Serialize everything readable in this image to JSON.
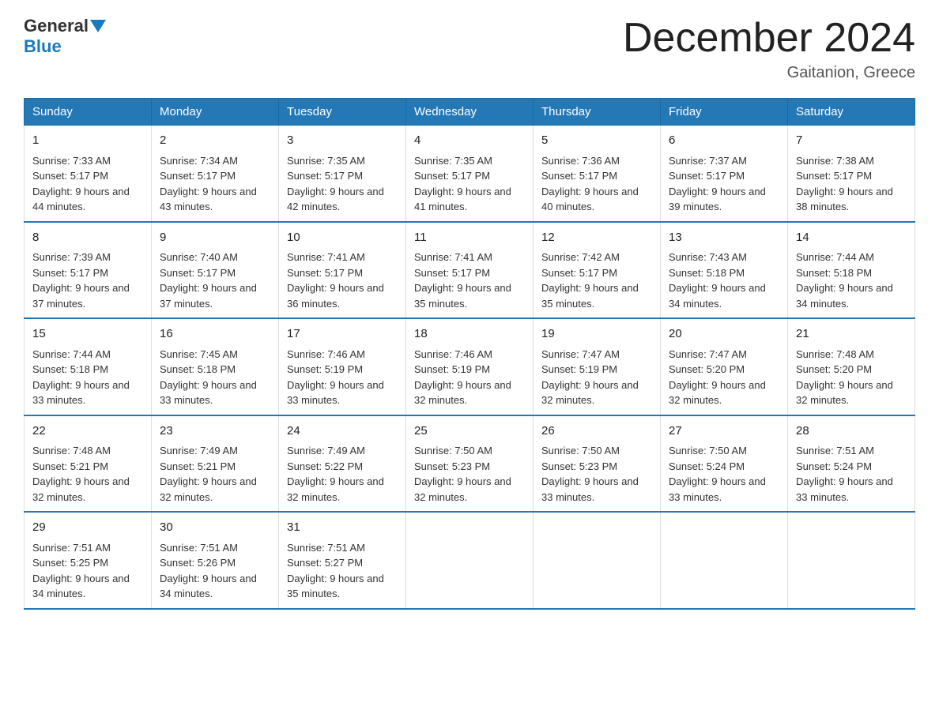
{
  "header": {
    "logo_general": "General",
    "logo_blue": "Blue",
    "title": "December 2024",
    "location": "Gaitanion, Greece"
  },
  "weekdays": [
    "Sunday",
    "Monday",
    "Tuesday",
    "Wednesday",
    "Thursday",
    "Friday",
    "Saturday"
  ],
  "weeks": [
    [
      {
        "day": "1",
        "sunrise": "7:33 AM",
        "sunset": "5:17 PM",
        "daylight": "9 hours and 44 minutes."
      },
      {
        "day": "2",
        "sunrise": "7:34 AM",
        "sunset": "5:17 PM",
        "daylight": "9 hours and 43 minutes."
      },
      {
        "day": "3",
        "sunrise": "7:35 AM",
        "sunset": "5:17 PM",
        "daylight": "9 hours and 42 minutes."
      },
      {
        "day": "4",
        "sunrise": "7:35 AM",
        "sunset": "5:17 PM",
        "daylight": "9 hours and 41 minutes."
      },
      {
        "day": "5",
        "sunrise": "7:36 AM",
        "sunset": "5:17 PM",
        "daylight": "9 hours and 40 minutes."
      },
      {
        "day": "6",
        "sunrise": "7:37 AM",
        "sunset": "5:17 PM",
        "daylight": "9 hours and 39 minutes."
      },
      {
        "day": "7",
        "sunrise": "7:38 AM",
        "sunset": "5:17 PM",
        "daylight": "9 hours and 38 minutes."
      }
    ],
    [
      {
        "day": "8",
        "sunrise": "7:39 AM",
        "sunset": "5:17 PM",
        "daylight": "9 hours and 37 minutes."
      },
      {
        "day": "9",
        "sunrise": "7:40 AM",
        "sunset": "5:17 PM",
        "daylight": "9 hours and 37 minutes."
      },
      {
        "day": "10",
        "sunrise": "7:41 AM",
        "sunset": "5:17 PM",
        "daylight": "9 hours and 36 minutes."
      },
      {
        "day": "11",
        "sunrise": "7:41 AM",
        "sunset": "5:17 PM",
        "daylight": "9 hours and 35 minutes."
      },
      {
        "day": "12",
        "sunrise": "7:42 AM",
        "sunset": "5:17 PM",
        "daylight": "9 hours and 35 minutes."
      },
      {
        "day": "13",
        "sunrise": "7:43 AM",
        "sunset": "5:18 PM",
        "daylight": "9 hours and 34 minutes."
      },
      {
        "day": "14",
        "sunrise": "7:44 AM",
        "sunset": "5:18 PM",
        "daylight": "9 hours and 34 minutes."
      }
    ],
    [
      {
        "day": "15",
        "sunrise": "7:44 AM",
        "sunset": "5:18 PM",
        "daylight": "9 hours and 33 minutes."
      },
      {
        "day": "16",
        "sunrise": "7:45 AM",
        "sunset": "5:18 PM",
        "daylight": "9 hours and 33 minutes."
      },
      {
        "day": "17",
        "sunrise": "7:46 AM",
        "sunset": "5:19 PM",
        "daylight": "9 hours and 33 minutes."
      },
      {
        "day": "18",
        "sunrise": "7:46 AM",
        "sunset": "5:19 PM",
        "daylight": "9 hours and 32 minutes."
      },
      {
        "day": "19",
        "sunrise": "7:47 AM",
        "sunset": "5:19 PM",
        "daylight": "9 hours and 32 minutes."
      },
      {
        "day": "20",
        "sunrise": "7:47 AM",
        "sunset": "5:20 PM",
        "daylight": "9 hours and 32 minutes."
      },
      {
        "day": "21",
        "sunrise": "7:48 AM",
        "sunset": "5:20 PM",
        "daylight": "9 hours and 32 minutes."
      }
    ],
    [
      {
        "day": "22",
        "sunrise": "7:48 AM",
        "sunset": "5:21 PM",
        "daylight": "9 hours and 32 minutes."
      },
      {
        "day": "23",
        "sunrise": "7:49 AM",
        "sunset": "5:21 PM",
        "daylight": "9 hours and 32 minutes."
      },
      {
        "day": "24",
        "sunrise": "7:49 AM",
        "sunset": "5:22 PM",
        "daylight": "9 hours and 32 minutes."
      },
      {
        "day": "25",
        "sunrise": "7:50 AM",
        "sunset": "5:23 PM",
        "daylight": "9 hours and 32 minutes."
      },
      {
        "day": "26",
        "sunrise": "7:50 AM",
        "sunset": "5:23 PM",
        "daylight": "9 hours and 33 minutes."
      },
      {
        "day": "27",
        "sunrise": "7:50 AM",
        "sunset": "5:24 PM",
        "daylight": "9 hours and 33 minutes."
      },
      {
        "day": "28",
        "sunrise": "7:51 AM",
        "sunset": "5:24 PM",
        "daylight": "9 hours and 33 minutes."
      }
    ],
    [
      {
        "day": "29",
        "sunrise": "7:51 AM",
        "sunset": "5:25 PM",
        "daylight": "9 hours and 34 minutes."
      },
      {
        "day": "30",
        "sunrise": "7:51 AM",
        "sunset": "5:26 PM",
        "daylight": "9 hours and 34 minutes."
      },
      {
        "day": "31",
        "sunrise": "7:51 AM",
        "sunset": "5:27 PM",
        "daylight": "9 hours and 35 minutes."
      },
      null,
      null,
      null,
      null
    ]
  ]
}
